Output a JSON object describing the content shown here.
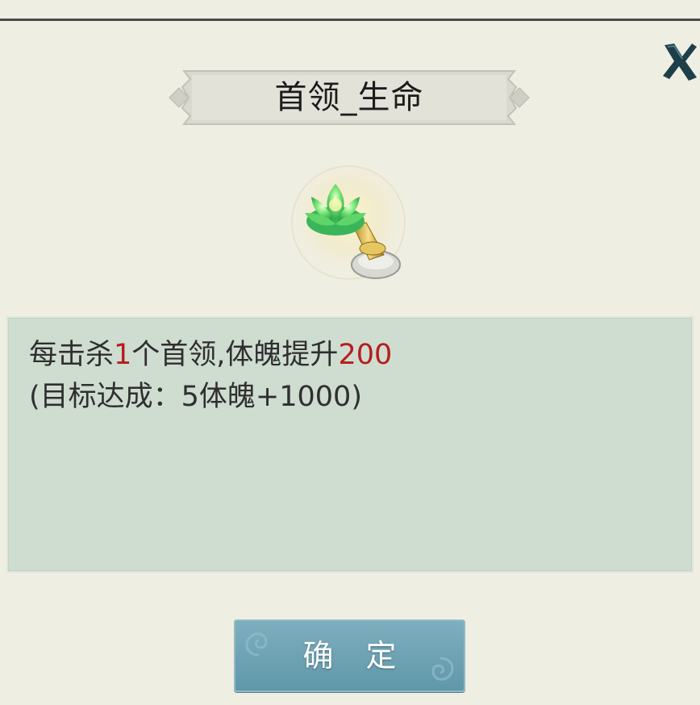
{
  "dialog": {
    "title": "首领_生命",
    "item_icon": "green-lotus-lamp-icon",
    "description": {
      "line1": {
        "prefix": "每击杀",
        "kill_count": "1",
        "middle": "个首领,体魄提升",
        "bonus": "200"
      },
      "line2": "(目标达成：5体魄+1000)"
    },
    "confirm_label": "确 定",
    "close_icon": "close-x-icon"
  },
  "colors": {
    "background": "#efeee2",
    "panel": "#cfdcd0",
    "highlight_red": "#b51d1d",
    "button": "#6fa3b4"
  }
}
